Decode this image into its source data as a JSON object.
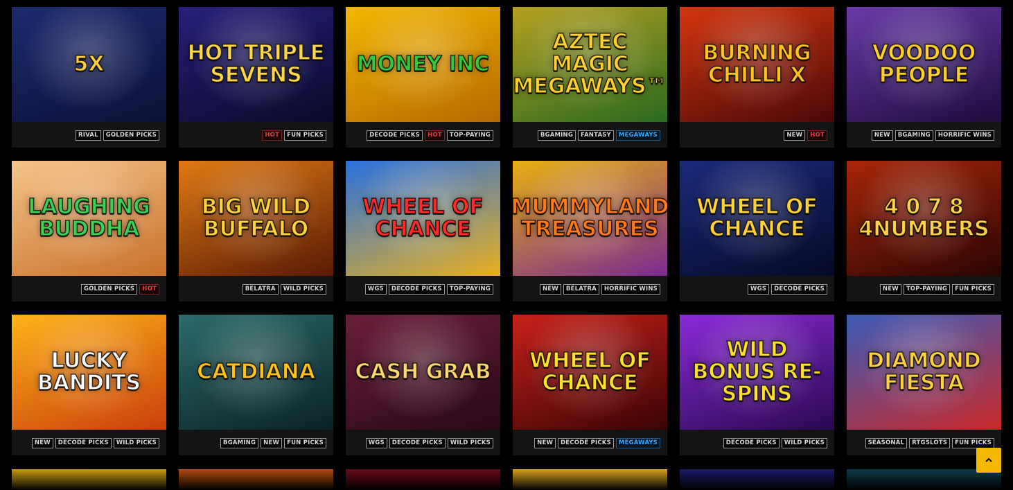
{
  "games": [
    {
      "title": "5x",
      "tags": [
        "RIVAL",
        "GOLDEN PICKS"
      ],
      "bg": "#1c2a6e",
      "bg2": "#0b1238",
      "fg": "#ffcf40"
    },
    {
      "title": "Hot Triple Sevens",
      "tags": [
        "HOT",
        "FUN PICKS"
      ],
      "bg": "#27207a",
      "bg2": "#0a0a2a",
      "fg": "#ffd84a"
    },
    {
      "title": "Money Inc",
      "tags": [
        "DECODE PICKS",
        "HOT",
        "TOP-PAYING"
      ],
      "bg": "#f2b800",
      "bg2": "#b86800",
      "fg": "#33c93a"
    },
    {
      "title": "Aztec Magic Megaways™",
      "tags": [
        "BGAMING",
        "FANTASY",
        "MEGAWAYS"
      ],
      "bg": "#b5a020",
      "bg2": "#2a6a20",
      "fg": "#ffd030"
    },
    {
      "title": "Burning Chilli X",
      "tags": [
        "NEW",
        "HOT"
      ],
      "bg": "#d4360f",
      "bg2": "#4a0808",
      "fg": "#ffc21e"
    },
    {
      "title": "Voodoo People",
      "tags": [
        "NEW",
        "BGAMING",
        "HORRIFIC WINS"
      ],
      "bg": "#6a3aa8",
      "bg2": "#1f0b3c",
      "fg": "#ffd02a"
    },
    {
      "title": "Laughing Buddha",
      "tags": [
        "GOLDEN PICKS",
        "HOT"
      ],
      "bg": "#f4c489",
      "bg2": "#c8702a",
      "fg": "#3ccf58"
    },
    {
      "title": "Big Wild Buffalo",
      "tags": [
        "BELATRA",
        "WILD PICKS"
      ],
      "bg": "#e07a12",
      "bg2": "#5a1a06",
      "fg": "#ffd23a"
    },
    {
      "title": "Wheel of Chance",
      "tags": [
        "WGS",
        "DECODE PICKS",
        "TOP-PAYING"
      ],
      "bg": "#2870e0",
      "bg2": "#e8b020",
      "fg": "#ff2a2a"
    },
    {
      "title": "Mummyland Treasures",
      "tags": [
        "NEW",
        "BELATRA",
        "HORRIFIC WINS"
      ],
      "bg": "#e8b012",
      "bg2": "#7a2a90",
      "fg": "#ff7a1a"
    },
    {
      "title": "Wheel of Chance",
      "tags": [
        "WGS",
        "DECODE PICKS"
      ],
      "bg": "#1a2a7a",
      "bg2": "#050a28",
      "fg": "#ffd23a"
    },
    {
      "title": "4 0 7 8 4Numbers",
      "tags": [
        "NEW",
        "TOP-PAYING",
        "FUN PICKS"
      ],
      "bg": "#a8260a",
      "bg2": "#2a0502",
      "fg": "#ffd24a"
    },
    {
      "title": "Lucky Bandits",
      "tags": [
        "NEW",
        "DECODE PICKS",
        "WILD PICKS"
      ],
      "bg": "#ffb21a",
      "bg2": "#c8400a",
      "fg": "#ffffff"
    },
    {
      "title": "Catdiana",
      "tags": [
        "BGAMING",
        "NEW",
        "FUN PICKS"
      ],
      "bg": "#2c6a6a",
      "bg2": "#0a2226",
      "fg": "#ffc21a"
    },
    {
      "title": "Cash Grab",
      "tags": [
        "WGS",
        "DECODE PICKS",
        "WILD PICKS"
      ],
      "bg": "#6a1e3a",
      "bg2": "#2a0818",
      "fg": "#ffd870"
    },
    {
      "title": "Wheel of Chance",
      "tags": [
        "NEW",
        "DECODE PICKS",
        "MEGAWAYS"
      ],
      "bg": "#c8201a",
      "bg2": "#3a0404",
      "fg": "#ffe02a"
    },
    {
      "title": "Wild Bonus Re-Spins",
      "tags": [
        "DECODE PICKS",
        "WILD PICKS"
      ],
      "bg": "#8a2ad8",
      "bg2": "#2a0850",
      "fg": "#ffe02a"
    },
    {
      "title": "Diamond Fiesta",
      "tags": [
        "SEASONAL",
        "RTGSLOTS",
        "FUN PICKS"
      ],
      "bg": "#3a5ab8",
      "bg2": "#c82a2a",
      "fg": "#ffd040"
    }
  ],
  "peek_colors": [
    "#c89a10",
    "#b04a10",
    "#6a0a1a",
    "#d8a020",
    "#1a1a6a",
    "#0a3a4a"
  ],
  "scroll_top": {
    "icon": "chevron-up-icon",
    "color": "#f5b800"
  }
}
